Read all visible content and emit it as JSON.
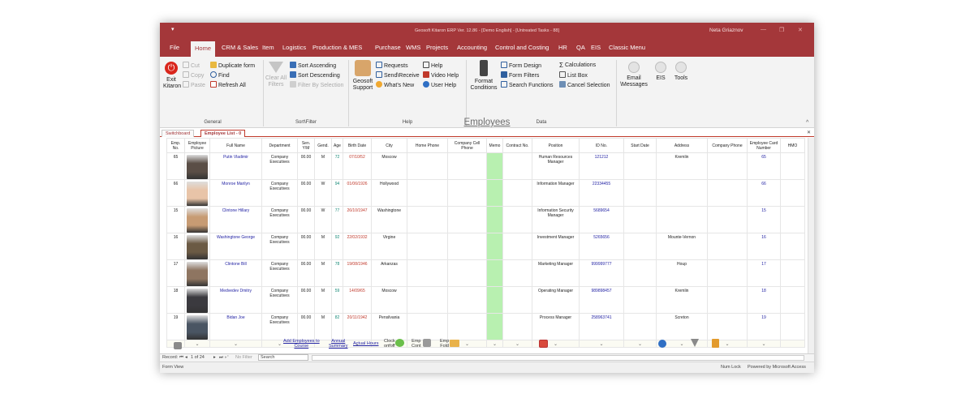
{
  "window": {
    "title": "Geosoft Kitaron ERP Ver. 12.86 - [Demo English] - [Untreated Tasks - 88]",
    "user": "Neta Griaznov"
  },
  "menu_tabs": [
    "File",
    "Home",
    "CRM & Sales",
    "Item",
    "Logistics",
    "Production & MES",
    "Purchase",
    "WMS",
    "Projects",
    "Accounting",
    "Control and Costing",
    "HR",
    "QA",
    "EIS",
    "Classic Menu"
  ],
  "ribbon": {
    "exit": "Exit\nKitaron",
    "cut": "Cut",
    "copy": "Copy",
    "paste": "Paste",
    "duplicate_form": "Duplicate form",
    "find": "Find",
    "refresh_all": "Refresh All",
    "general": "General",
    "clear_all_filters": "Clear All\nFilters",
    "sort_ascending": "Sort  Ascending",
    "sort_descending": "Sort Descending",
    "filter_by_selection": "Filter By Selection",
    "sort_filter": "Sort\\Filter",
    "geosoft_support": "Geosoft\nSupport",
    "requests": "Requests",
    "send_receive": "Send\\Receive",
    "whats_new": "What's New",
    "help": "Help",
    "video_help": "Video Help",
    "user_help": "User Help",
    "help_group": "Help",
    "format_conditions": "Format\nConditions",
    "form_design": "Form Design",
    "form_filters": "Form Filters",
    "search_functions": "Search Functions",
    "calculations": "Calculations",
    "list_box": "List Box",
    "cancel_selection": "Cancel Selection",
    "data_group": "Data",
    "email": "Email\n\\Messages",
    "eis": "EIS",
    "tools": "Tools"
  },
  "doc_tabs": [
    "Switchboard",
    "Employee List - 0"
  ],
  "form_title": "Employees",
  "columns": [
    "Emp. No.",
    "Employee Picture",
    "Full Name",
    "Department",
    "Sen. Y\\M",
    "Gend.",
    "Age",
    "Birth Date",
    "City",
    "Home Phone",
    "Company Cell Phone",
    "Memo",
    "Contract No.",
    "Position",
    "ID No.",
    "Start Date",
    "Address",
    "Company Phone",
    "Employee Card Number",
    "HMO"
  ],
  "employees": [
    {
      "no": "65",
      "name": "Putin Vladimir",
      "dept": "Company Executives",
      "sen": "00.00",
      "gend": "M",
      "age": "72",
      "birth": "07/10/52",
      "city": "Moscow",
      "position": "Human Resources Manager",
      "id": "121212",
      "address": "Kremlin",
      "card": "65",
      "photo": "#5a4e46"
    },
    {
      "no": "66",
      "name": "Monroe Marilyn",
      "dept": "Company Executives",
      "sen": "00.00",
      "gend": "W",
      "age": "94",
      "birth": "01/06/1926",
      "city": "Hollywood",
      "position": "Information Manager",
      "id": "22334455",
      "address": "",
      "card": "66",
      "photo": "#e8c4a8"
    },
    {
      "no": "15",
      "name": "Clintone Hillary",
      "dept": "Company Executives",
      "sen": "00.00",
      "gend": "W",
      "age": "77",
      "birth": "26/10/1947",
      "city": "Washingtone",
      "position": "Information Security Manager",
      "id": "5689654",
      "address": "",
      "card": "15",
      "photo": "#c79b73"
    },
    {
      "no": "16",
      "name": "Washingtone George",
      "dept": "Company Executives",
      "sen": "00.00",
      "gend": "M",
      "age": "92",
      "birth": "22/02/1932",
      "city": "Virgine",
      "position": "Investment Manager",
      "id": "5265656",
      "address": "Mounte-Vernon",
      "card": "16",
      "photo": "#6b5a44"
    },
    {
      "no": "17",
      "name": "Clintone Bill",
      "dept": "Company Executives",
      "sen": "00.00",
      "gend": "M",
      "age": "78",
      "birth": "19/08/1946",
      "city": "Arkanzas",
      "position": "Marketing Manager",
      "id": "999999777",
      "address": "Houp",
      "card": "17",
      "photo": "#8e7561"
    },
    {
      "no": "18",
      "name": "Medvedev Dmitry",
      "dept": "Company Executives",
      "sen": "00.00",
      "gend": "M",
      "age": "59",
      "birth": "14/09/65",
      "city": "Moscow",
      "position": "Operating  Manager",
      "id": "989898457",
      "address": "Kremlin",
      "card": "18",
      "photo": "#3b3a3f"
    },
    {
      "no": "19",
      "name": "Bidan Joe",
      "dept": "Company Executives",
      "sen": "00.00",
      "gend": "M",
      "age": "82",
      "birth": "20/11/1942",
      "city": "Pensilvania",
      "position": "Process Manager",
      "id": "258963741",
      "address": "Screton",
      "card": "19",
      "photo": "#4a5563"
    }
  ],
  "footer": {
    "add_employees": "Add Employees to\nCourse",
    "annual_summary": "Annual\nSummary",
    "actual_hours": "Actual Hours",
    "clock_onoff": "Clock\non/off",
    "emp_cont": "Emp\nCont",
    "emp_fold": "Emp\nFold"
  },
  "nav": {
    "record": "Record:",
    "position": "1 of 24",
    "no_filter": "No Filter",
    "search": "Search"
  },
  "status": {
    "left": "Form View",
    "num_lock": "Num Lock",
    "powered": "Powered by Microsoft Access"
  }
}
